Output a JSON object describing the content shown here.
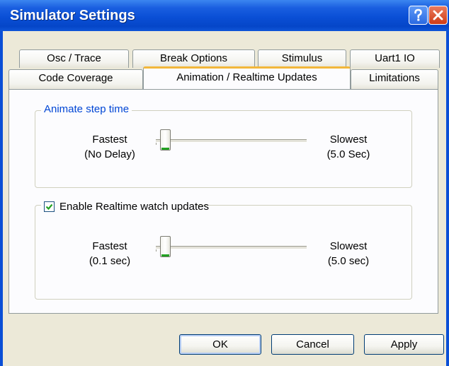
{
  "window": {
    "title": "Simulator Settings",
    "help_icon": "question-mark-icon",
    "close_icon": "close-icon",
    "colors": {
      "titlebar": "#0a4fd6",
      "face": "#ece9d8",
      "panel": "#fcfcfe",
      "active_tab_accent": "#f2b73a"
    }
  },
  "tabs": {
    "row1": [
      {
        "label": "Osc / Trace"
      },
      {
        "label": "Break Options"
      },
      {
        "label": "Stimulus"
      },
      {
        "label": "Uart1  IO"
      }
    ],
    "row2": [
      {
        "label": "Code Coverage"
      },
      {
        "label": "Animation / Realtime  Updates",
        "selected": true
      },
      {
        "label": "Limitations"
      }
    ]
  },
  "animate_group": {
    "title": "Animate step time",
    "left_label_1": "Fastest",
    "left_label_2": "(No Delay)",
    "right_label_1": "Slowest",
    "right_label_2": "(5.0 Sec)",
    "slider_level": 0
  },
  "realtime_group": {
    "checkbox_label": "Enable Realtime watch updates",
    "checked": true,
    "left_label_1": "Fastest",
    "left_label_2": "(0.1 sec)",
    "right_label_1": "Slowest",
    "right_label_2": "(5.0 sec)",
    "slider_level": 0
  },
  "buttons": {
    "ok": "OK",
    "cancel": "Cancel",
    "apply": "Apply"
  }
}
